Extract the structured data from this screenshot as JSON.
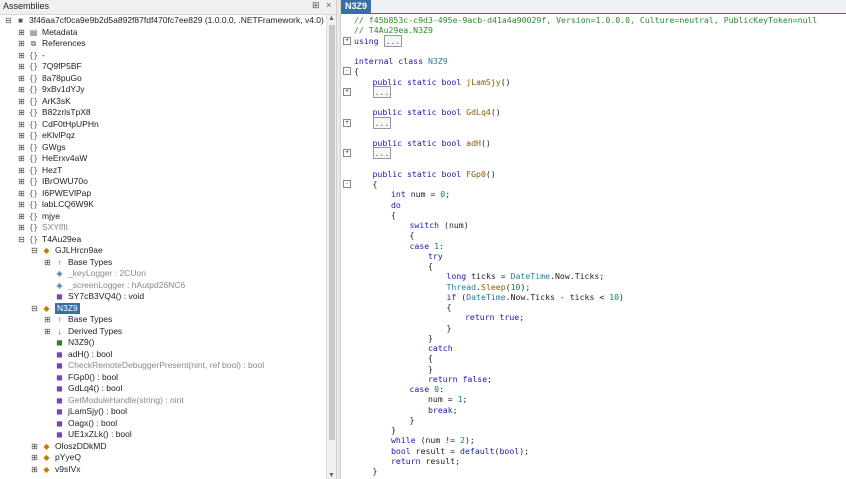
{
  "left_panel": {
    "title": "Assemblies",
    "pin_label": "⊞",
    "close_label": "×",
    "tree": [
      {
        "depth": 0,
        "toggle": "-",
        "icon": "assembly",
        "label": "3f46aa7cf0ca9e9b2d5a892f87fdf470fc7ee829 (1.0.0.0, .NETFramework, v4.0)"
      },
      {
        "depth": 1,
        "toggle": "+",
        "icon": "metadata",
        "label": "Metadata"
      },
      {
        "depth": 1,
        "toggle": "+",
        "icon": "references",
        "label": "References"
      },
      {
        "depth": 1,
        "toggle": "+",
        "icon": "namespace",
        "label": "-"
      },
      {
        "depth": 1,
        "toggle": "+",
        "icon": "namespace",
        "label": "7Q9fP5BF"
      },
      {
        "depth": 1,
        "toggle": "+",
        "icon": "namespace",
        "label": "8a78puGo"
      },
      {
        "depth": 1,
        "toggle": "+",
        "icon": "namespace",
        "label": "9xBv1dYJy"
      },
      {
        "depth": 1,
        "toggle": "+",
        "icon": "namespace",
        "label": "ArK3sK"
      },
      {
        "depth": 1,
        "toggle": "+",
        "icon": "namespace",
        "label": "B82zrlsTpX8"
      },
      {
        "depth": 1,
        "toggle": "+",
        "icon": "namespace",
        "label": "CdF0tHpUPHn"
      },
      {
        "depth": 1,
        "toggle": "+",
        "icon": "namespace",
        "label": "eKlvlPqz"
      },
      {
        "depth": 1,
        "toggle": "+",
        "icon": "namespace",
        "label": "GWgs"
      },
      {
        "depth": 1,
        "toggle": "+",
        "icon": "namespace",
        "label": "HeErxv4aW"
      },
      {
        "depth": 1,
        "toggle": "+",
        "icon": "namespace",
        "label": "HezT"
      },
      {
        "depth": 1,
        "toggle": "+",
        "icon": "namespace",
        "label": "IBrOWU70o"
      },
      {
        "depth": 1,
        "toggle": "+",
        "icon": "namespace",
        "label": "I6PWEVlPap"
      },
      {
        "depth": 1,
        "toggle": "+",
        "icon": "namespace",
        "label": "labLCQ6W9K"
      },
      {
        "depth": 1,
        "toggle": "+",
        "icon": "namespace",
        "label": "mjye"
      },
      {
        "depth": 1,
        "toggle": "+",
        "icon": "namespace",
        "label": "SXYlfIt",
        "gray": true
      },
      {
        "depth": 1,
        "toggle": "-",
        "icon": "namespace",
        "label": "T4Au29ea"
      },
      {
        "depth": 2,
        "toggle": "-",
        "icon": "class",
        "label": "GJLHrcn9ae"
      },
      {
        "depth": 3,
        "toggle": "+",
        "icon": "basetypes",
        "label": "Base Types"
      },
      {
        "depth": 3,
        "toggle": "",
        "icon": "field",
        "label": "_keyLogger : 2CUon",
        "gray": true
      },
      {
        "depth": 3,
        "toggle": "",
        "icon": "field",
        "label": "_screenLogger : hAutpd26NC6",
        "gray": true
      },
      {
        "depth": 3,
        "toggle": "",
        "icon": "method",
        "label": "SY7cB3VQ4() : void"
      },
      {
        "depth": 2,
        "toggle": "-",
        "icon": "class",
        "label": "N3Z9",
        "selected": true
      },
      {
        "depth": 3,
        "toggle": "+",
        "icon": "basetypes",
        "label": "Base Types"
      },
      {
        "depth": 3,
        "toggle": "+",
        "icon": "derivedtypes",
        "label": "Derived Types"
      },
      {
        "depth": 3,
        "toggle": "",
        "icon": "ctor",
        "label": "N3Z9()"
      },
      {
        "depth": 3,
        "toggle": "",
        "icon": "method",
        "label": "adH() : bool"
      },
      {
        "depth": 3,
        "toggle": "",
        "icon": "method",
        "label": "CheckRemoteDebuggerPresent(nint, ref bool) : bool",
        "gray": true
      },
      {
        "depth": 3,
        "toggle": "",
        "icon": "method",
        "label": "FGp0() : bool"
      },
      {
        "depth": 3,
        "toggle": "",
        "icon": "method",
        "label": "GdLq4() : bool"
      },
      {
        "depth": 3,
        "toggle": "",
        "icon": "method",
        "label": "GetModuleHandle(string) : nint",
        "gray": true
      },
      {
        "depth": 3,
        "toggle": "",
        "icon": "method",
        "label": "jLamSjy() : bool"
      },
      {
        "depth": 3,
        "toggle": "",
        "icon": "method",
        "label": "Oagx() : bool"
      },
      {
        "depth": 3,
        "toggle": "",
        "icon": "method",
        "label": "UE1xZLk() : bool"
      },
      {
        "depth": 2,
        "toggle": "+",
        "icon": "class",
        "label": "OloszDDkMD"
      },
      {
        "depth": 2,
        "toggle": "+",
        "icon": "class",
        "label": "pYyeQ"
      },
      {
        "depth": 2,
        "toggle": "+",
        "icon": "class",
        "label": "v9sIVx"
      }
    ]
  },
  "editor": {
    "tab_label": "N3Z9",
    "lines": [
      {
        "fold": "",
        "indent": 0,
        "parts": [
          [
            "cm",
            "// f45b853c-c9d3-495e-9acb-d41a4a90029f, Version=1.0.0.0, Culture=neutral, PublicKeyToken=null"
          ]
        ]
      },
      {
        "fold": "",
        "indent": 0,
        "parts": [
          [
            "cm",
            "// T4Au29ea.N3Z9"
          ]
        ]
      },
      {
        "fold": "+",
        "indent": 0,
        "parts": [
          [
            "kw",
            "using "
          ],
          [
            "box",
            "..."
          ]
        ]
      },
      {
        "fold": "",
        "indent": 0,
        "parts": []
      },
      {
        "fold": "",
        "indent": 0,
        "parts": [
          [
            "kw",
            "internal class "
          ],
          [
            "tp",
            "N3Z9"
          ]
        ]
      },
      {
        "fold": "-",
        "indent": 0,
        "parts": [
          [
            "var",
            "{"
          ]
        ]
      },
      {
        "fold": "",
        "indent": 1,
        "parts": [
          [
            "kw",
            "public static bool "
          ],
          [
            "mt",
            "jLamSjy"
          ],
          [
            "var",
            "()"
          ]
        ]
      },
      {
        "fold": "+",
        "indent": 1,
        "parts": [
          [
            "box",
            "..."
          ]
        ]
      },
      {
        "fold": "",
        "indent": 0,
        "parts": []
      },
      {
        "fold": "",
        "indent": 1,
        "parts": [
          [
            "kw",
            "public static bool "
          ],
          [
            "mt",
            "GdLq4"
          ],
          [
            "var",
            "()"
          ]
        ]
      },
      {
        "fold": "+",
        "indent": 1,
        "parts": [
          [
            "box",
            "..."
          ]
        ]
      },
      {
        "fold": "",
        "indent": 0,
        "parts": []
      },
      {
        "fold": "",
        "indent": 1,
        "parts": [
          [
            "kw",
            "public static bool "
          ],
          [
            "mt",
            "adH"
          ],
          [
            "var",
            "()"
          ]
        ]
      },
      {
        "fold": "+",
        "indent": 1,
        "parts": [
          [
            "box",
            "..."
          ]
        ]
      },
      {
        "fold": "",
        "indent": 0,
        "parts": []
      },
      {
        "fold": "",
        "indent": 1,
        "parts": [
          [
            "kw",
            "public static bool "
          ],
          [
            "mt",
            "FGp0"
          ],
          [
            "var",
            "()"
          ]
        ]
      },
      {
        "fold": "-",
        "indent": 1,
        "parts": [
          [
            "var",
            "{"
          ]
        ]
      },
      {
        "fold": "",
        "indent": 2,
        "parts": [
          [
            "kw",
            "int "
          ],
          [
            "var",
            "num = "
          ],
          [
            "nm",
            "0"
          ],
          [
            "var",
            ";"
          ]
        ]
      },
      {
        "fold": "",
        "indent": 2,
        "parts": [
          [
            "kw",
            "do"
          ]
        ]
      },
      {
        "fold": "",
        "indent": 2,
        "parts": [
          [
            "var",
            "{"
          ]
        ]
      },
      {
        "fold": "",
        "indent": 3,
        "parts": [
          [
            "kw",
            "switch "
          ],
          [
            "var",
            "(num)"
          ]
        ]
      },
      {
        "fold": "",
        "indent": 3,
        "parts": [
          [
            "var",
            "{"
          ]
        ]
      },
      {
        "fold": "",
        "indent": 3,
        "parts": [
          [
            "kw",
            "case "
          ],
          [
            "nm",
            "1"
          ],
          [
            "var",
            ":"
          ]
        ]
      },
      {
        "fold": "",
        "indent": 4,
        "parts": [
          [
            "kw",
            "try"
          ]
        ]
      },
      {
        "fold": "",
        "indent": 4,
        "parts": [
          [
            "var",
            "{"
          ]
        ]
      },
      {
        "fold": "",
        "indent": 5,
        "parts": [
          [
            "kw",
            "long "
          ],
          [
            "var",
            "ticks = "
          ],
          [
            "tp",
            "DateTime"
          ],
          [
            "var",
            "."
          ],
          [
            "var",
            "Now"
          ],
          [
            "var",
            "."
          ],
          [
            "var",
            "Ticks;"
          ]
        ]
      },
      {
        "fold": "",
        "indent": 5,
        "parts": [
          [
            "tp",
            "Thread"
          ],
          [
            "var",
            "."
          ],
          [
            "mt",
            "Sleep"
          ],
          [
            "var",
            "("
          ],
          [
            "nm",
            "10"
          ],
          [
            "var",
            ");"
          ]
        ]
      },
      {
        "fold": "",
        "indent": 5,
        "parts": [
          [
            "kw",
            "if "
          ],
          [
            "var",
            "("
          ],
          [
            "tp",
            "DateTime"
          ],
          [
            "var",
            ".Now.Ticks - ticks < "
          ],
          [
            "nm",
            "10"
          ],
          [
            "var",
            ")"
          ]
        ]
      },
      {
        "fold": "",
        "indent": 5,
        "parts": [
          [
            "var",
            "{"
          ]
        ]
      },
      {
        "fold": "",
        "indent": 6,
        "parts": [
          [
            "kw",
            "return true"
          ],
          [
            "var",
            ";"
          ]
        ]
      },
      {
        "fold": "",
        "indent": 5,
        "parts": [
          [
            "var",
            "}"
          ]
        ]
      },
      {
        "fold": "",
        "indent": 4,
        "parts": [
          [
            "var",
            "}"
          ]
        ]
      },
      {
        "fold": "",
        "indent": 4,
        "parts": [
          [
            "kw",
            "catch"
          ]
        ]
      },
      {
        "fold": "",
        "indent": 4,
        "parts": [
          [
            "var",
            "{"
          ]
        ]
      },
      {
        "fold": "",
        "indent": 4,
        "parts": [
          [
            "var",
            "}"
          ]
        ]
      },
      {
        "fold": "",
        "indent": 4,
        "parts": [
          [
            "kw",
            "return false"
          ],
          [
            "var",
            ";"
          ]
        ]
      },
      {
        "fold": "",
        "indent": 3,
        "parts": [
          [
            "kw",
            "case "
          ],
          [
            "nm",
            "0"
          ],
          [
            "var",
            ":"
          ]
        ]
      },
      {
        "fold": "",
        "indent": 4,
        "parts": [
          [
            "var",
            "num = "
          ],
          [
            "nm",
            "1"
          ],
          [
            "var",
            ";"
          ]
        ]
      },
      {
        "fold": "",
        "indent": 4,
        "parts": [
          [
            "kw",
            "break"
          ],
          [
            "var",
            ";"
          ]
        ]
      },
      {
        "fold": "",
        "indent": 3,
        "parts": [
          [
            "var",
            "}"
          ]
        ]
      },
      {
        "fold": "",
        "indent": 2,
        "parts": [
          [
            "var",
            "}"
          ]
        ]
      },
      {
        "fold": "",
        "indent": 2,
        "parts": [
          [
            "kw",
            "while "
          ],
          [
            "var",
            "(num != "
          ],
          [
            "nm",
            "2"
          ],
          [
            "var",
            ");"
          ]
        ]
      },
      {
        "fold": "",
        "indent": 2,
        "parts": [
          [
            "kw",
            "bool "
          ],
          [
            "var",
            "result = "
          ],
          [
            "kw",
            "default"
          ],
          [
            "var",
            "("
          ],
          [
            "kw",
            "bool"
          ],
          [
            "var",
            ");"
          ]
        ]
      },
      {
        "fold": "",
        "indent": 2,
        "parts": [
          [
            "kw",
            "return "
          ],
          [
            "var",
            "result;"
          ]
        ]
      },
      {
        "fold": "",
        "indent": 1,
        "parts": [
          [
            "var",
            "}"
          ]
        ]
      }
    ]
  }
}
